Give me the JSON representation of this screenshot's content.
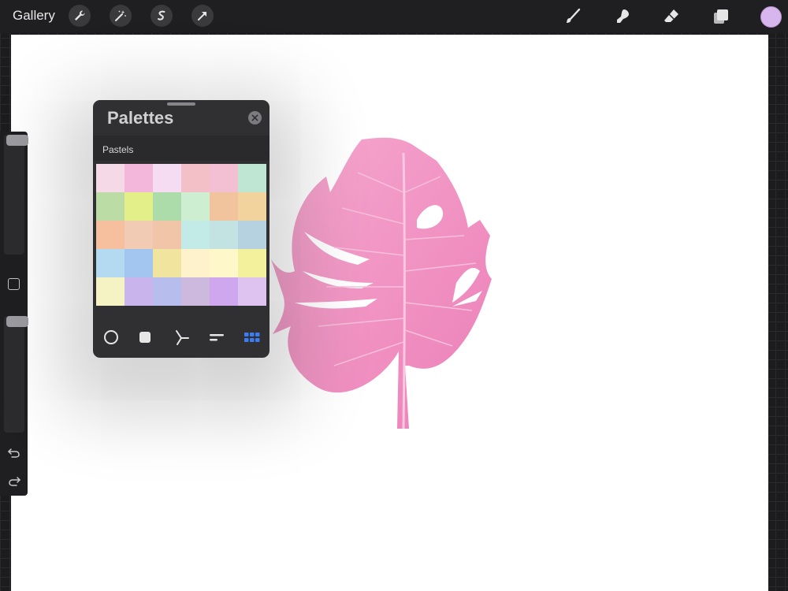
{
  "topbar": {
    "gallery_label": "Gallery",
    "left_tools": [
      "wrench-icon",
      "magic-wand-icon",
      "selection-icon",
      "transform-arrow-icon"
    ],
    "right_tools": [
      "brush-icon",
      "smudge-icon",
      "eraser-icon",
      "layers-icon"
    ],
    "current_color": "#d6b6ec"
  },
  "sidebar": {
    "brush_size_level": 0.05,
    "opacity_level": 0.05
  },
  "palettes_panel": {
    "title": "Palettes",
    "palette_name": "Pastels",
    "swatches": [
      "#f6d9e6",
      "#f2b7da",
      "#f6dcf2",
      "#f2c0c6",
      "#f3bfd3",
      "#bfe6d3",
      "#bcdca6",
      "#e3ef88",
      "#acdca9",
      "#cdeed1",
      "#f1c49d",
      "#f2d39e",
      "#f6c09e",
      "#f2cbb4",
      "#f1c6a8",
      "#c2eae7",
      "#c2e3e1",
      "#b6d2e0",
      "#b4daf2",
      "#a3c6f0",
      "#f0e49e",
      "#fdf2cb",
      "#fdf7c9",
      "#f3f19c",
      "#f5f2c4",
      "#c9b5ec",
      "#b7bdec",
      "#cdb8de",
      "#cea7ee",
      "#dec3f0"
    ],
    "tabs": [
      "circle-disc-icon",
      "square-icon",
      "harmony-icon",
      "value-sliders-icon",
      "palettes-grid-icon"
    ],
    "active_tab": "palettes-grid-icon",
    "active_color": "#3d7cf2"
  },
  "canvas": {
    "leaf_color": "#f08fc0"
  }
}
